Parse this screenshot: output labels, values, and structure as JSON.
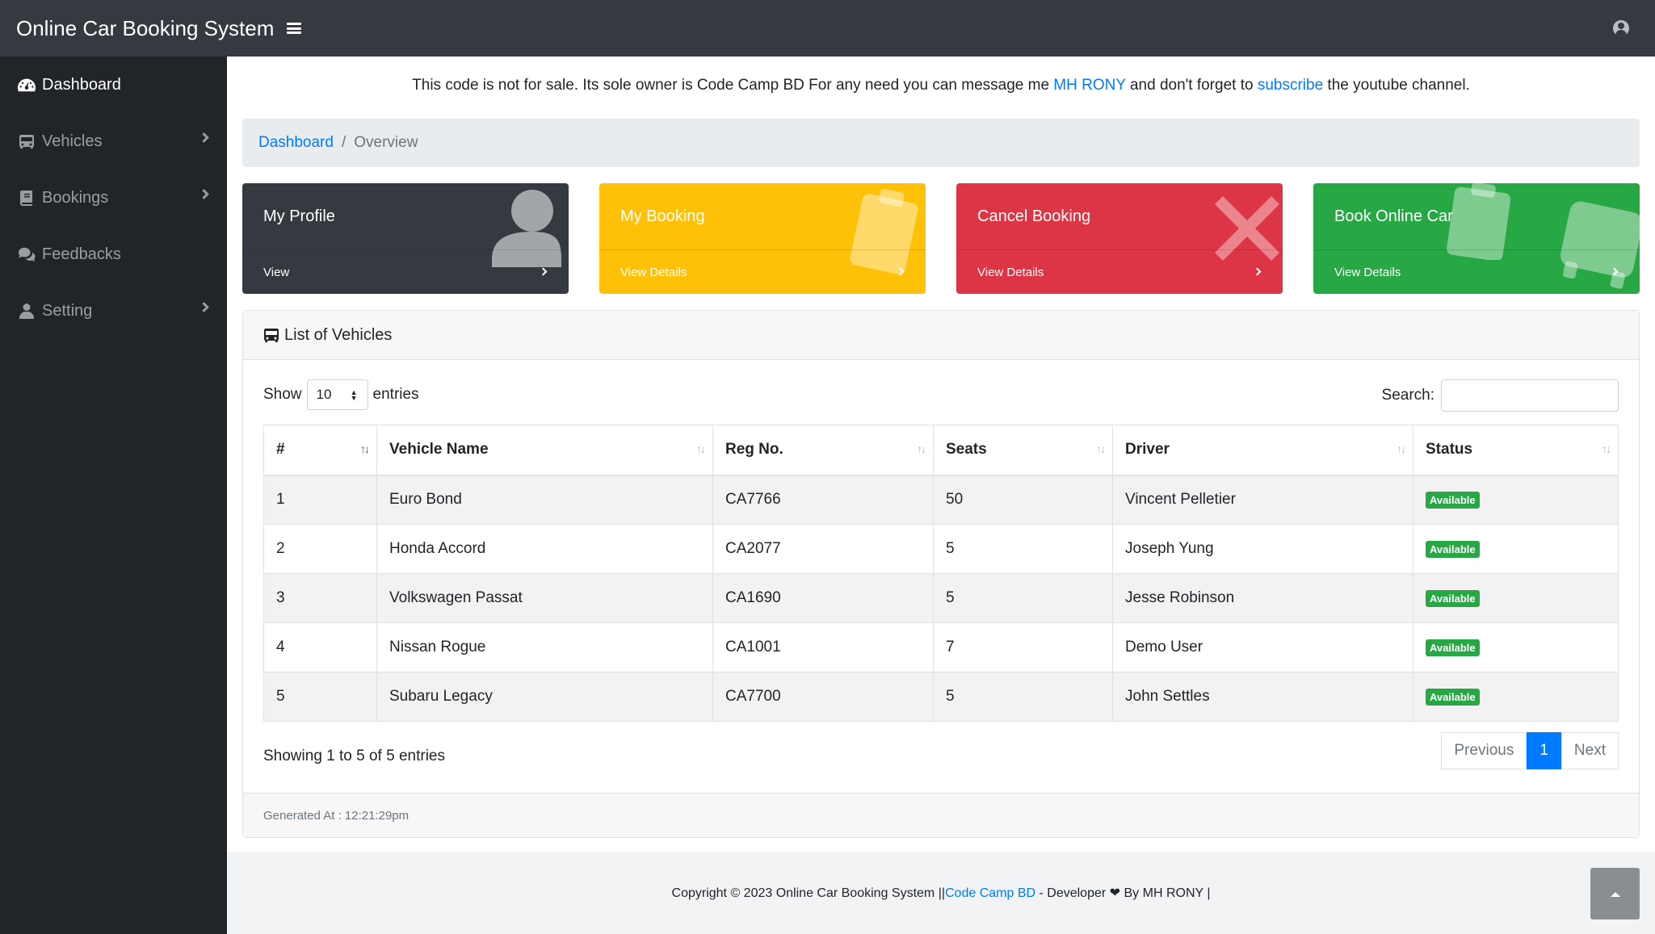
{
  "app": {
    "title": "Online Car Booking System"
  },
  "sidebar": {
    "items": [
      {
        "label": "Dashboard",
        "icon": "tachometer-icon"
      },
      {
        "label": "Vehicles",
        "icon": "bus-icon"
      },
      {
        "label": "Bookings",
        "icon": "book-icon"
      },
      {
        "label": "Feedbacks",
        "icon": "comments-icon"
      },
      {
        "label": "Setting",
        "icon": "user-icon"
      }
    ]
  },
  "notice": {
    "pre": "This code is not for sale. Its sole owner is Code Camp BD For any need you can message me ",
    "link1": "MH RONY",
    "mid": " and don't forget to ",
    "link2": "subscribe",
    "post": " the youtube channel."
  },
  "breadcrumb": {
    "home": "Dashboard",
    "current": "Overview"
  },
  "cards": [
    {
      "title": "My Profile",
      "link": "View",
      "color": "#343a40",
      "icon": "user-icon"
    },
    {
      "title": "My Booking",
      "link": "View Details",
      "color": "#ffc107",
      "icon": "clipboard-icon"
    },
    {
      "title": "Cancel Booking",
      "link": "View Details",
      "color": "#dc3545",
      "icon": "times-icon"
    },
    {
      "title": "Book Online Car",
      "link": "View Details",
      "color": "#28a745",
      "icon": "bus-icon"
    }
  ],
  "vehicles": {
    "title": "List of Vehicles",
    "show_label": "Show",
    "entries_value": "10",
    "entries_label": "entries",
    "search_label": "Search:",
    "search_value": "",
    "columns": [
      "#",
      "Vehicle Name",
      "Reg No.",
      "Seats",
      "Driver",
      "Status"
    ],
    "rows": [
      [
        "1",
        "Euro Bond",
        "CA7766",
        "50",
        "Vincent Pelletier",
        "Available"
      ],
      [
        "2",
        "Honda Accord",
        "CA2077",
        "5",
        "Joseph Yung",
        "Available"
      ],
      [
        "3",
        "Volkswagen Passat",
        "CA1690",
        "5",
        "Jesse Robinson",
        "Available"
      ],
      [
        "4",
        "Nissan Rogue",
        "CA1001",
        "7",
        "Demo User",
        "Available"
      ],
      [
        "5",
        "Subaru Legacy",
        "CA7700",
        "5",
        "John Settles",
        "Available"
      ]
    ],
    "info": "Showing 1 to 5 of 5 entries",
    "pagination": {
      "previous": "Previous",
      "current": "1",
      "next": "Next"
    },
    "generated": "Generated At : 12:21:29pm"
  },
  "footer": {
    "pre": "Copyright © 2023 Online Car Booking System ||",
    "link": "Code Camp BD",
    "mid": " - Developer ",
    "post": " By MH RONY |"
  }
}
